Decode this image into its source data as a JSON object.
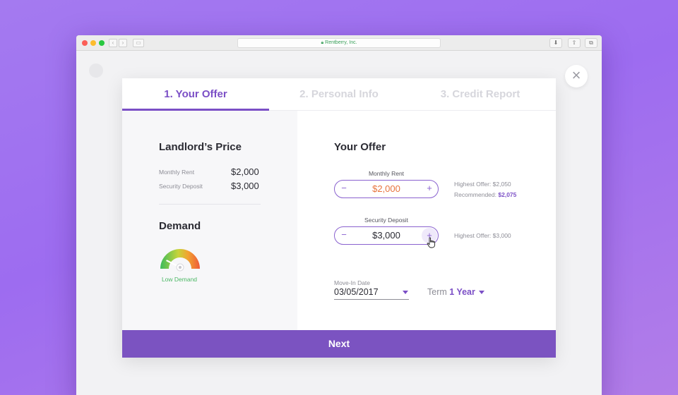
{
  "browser": {
    "url_text": "Rentberry, Inc.",
    "lock_icon": "lock-icon"
  },
  "modal": {
    "close_label": "×",
    "tabs": [
      {
        "label": "1. Your  Offer",
        "active": true
      },
      {
        "label": "2. Personal Info",
        "active": false
      },
      {
        "label": "3. Credit Report",
        "active": false
      }
    ],
    "landlord": {
      "title": "Landlord’s Price",
      "monthly_rent_label": "Monthly Rent",
      "monthly_rent_value": "$2,000",
      "security_deposit_label": "Security Deposit",
      "security_deposit_value": "$3,000"
    },
    "demand": {
      "title": "Demand",
      "level_label": "Low Demand",
      "level_fraction": 0.15
    },
    "offer": {
      "title": "Your Offer",
      "monthly_rent": {
        "label": "Monthly Rent",
        "value": "$2,000",
        "minus": "−",
        "plus": "+",
        "highest_offer": "Highest Offer: $2,050",
        "recommended_label": "Recommended: ",
        "recommended_value": "$2,075"
      },
      "security_deposit": {
        "label": "Security Deposit",
        "value": "$3,000",
        "minus": "−",
        "plus": "+",
        "highest_offer": "Highest Offer: $3,000"
      },
      "move_in": {
        "label": "Move-In Date",
        "value": "03/05/2017"
      },
      "term": {
        "label": "Term ",
        "value": "1 Year"
      }
    },
    "next_label": "Next"
  },
  "colors": {
    "accent": "#7b4fc6",
    "price_orange": "#e8733c",
    "demand_green": "#4cb865"
  }
}
